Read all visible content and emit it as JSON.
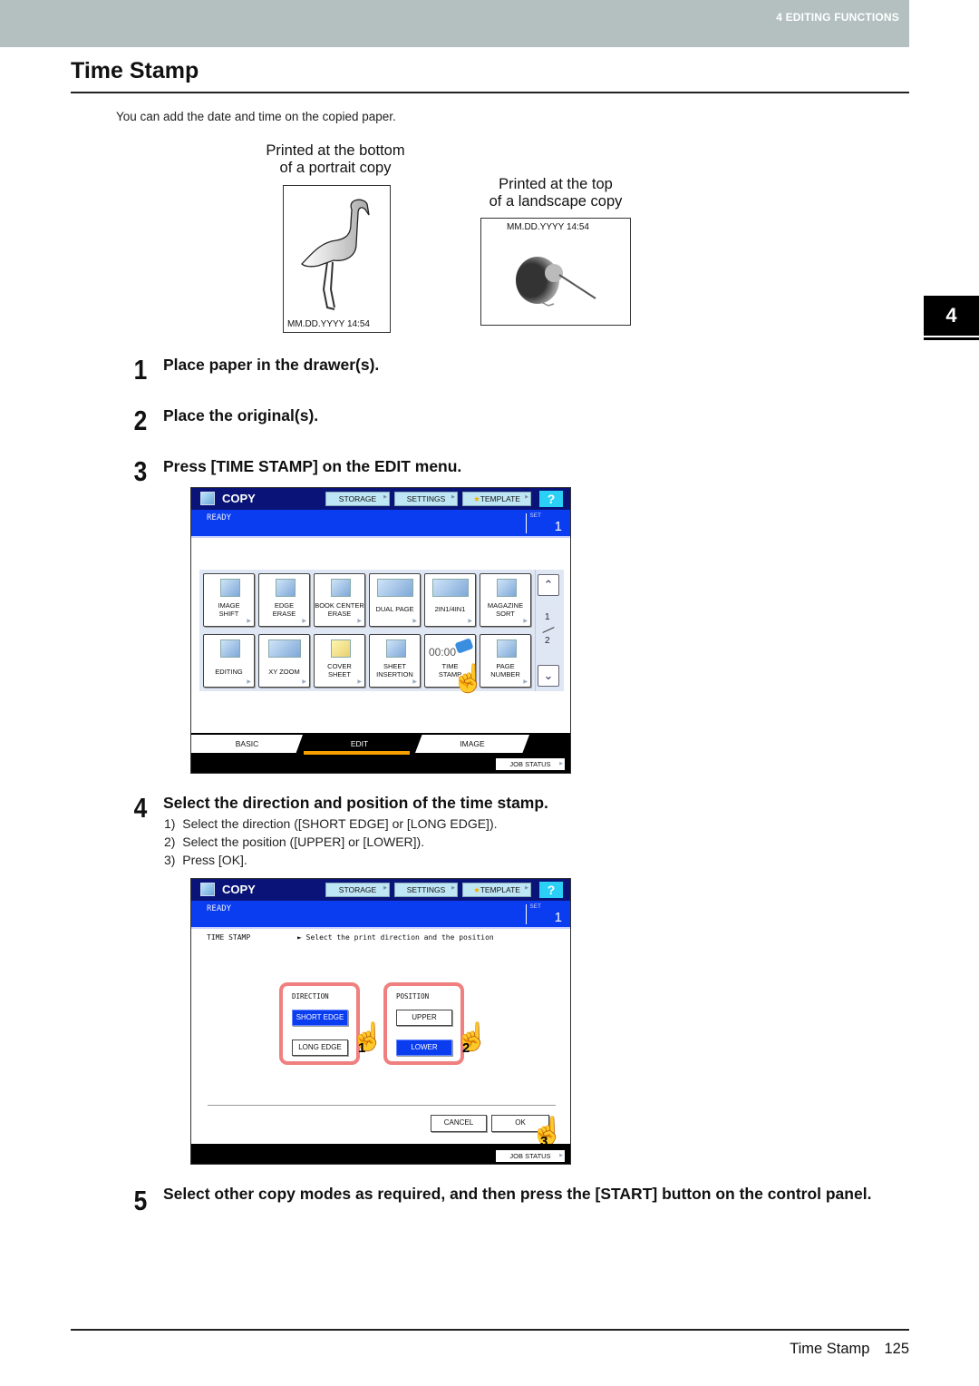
{
  "header": {
    "section": "4 EDITING FUNCTIONS"
  },
  "title": "Time Stamp",
  "intro": "You can add the date and time on the copied paper.",
  "illustrations": {
    "portrait": {
      "caption_line1": "Printed at the bottom",
      "caption_line2": "of a portrait copy",
      "stamp": "MM.DD.YYYY  14:54",
      "image": "flamingo"
    },
    "landscape": {
      "caption_line1": "Printed at the top",
      "caption_line2": "of a landscape copy",
      "stamp": "MM.DD.YYYY  14:54",
      "image": "kiwi"
    }
  },
  "chapter_tab": "4",
  "steps": [
    {
      "num": "1",
      "text": "Place paper in the drawer(s)."
    },
    {
      "num": "2",
      "text": "Place the original(s)."
    },
    {
      "num": "3",
      "text": "Press [TIME STAMP] on the EDIT menu."
    },
    {
      "num": "4",
      "text": "Select the direction and position of the time stamp.",
      "substeps": [
        {
          "n": "1)",
          "text": "Select the direction ([SHORT EDGE] or [LONG EDGE])."
        },
        {
          "n": "2)",
          "text": "Select the position ([UPPER] or [LOWER])."
        },
        {
          "n": "3)",
          "text": "Press [OK]."
        }
      ]
    },
    {
      "num": "5",
      "text": "Select other copy modes as required, and then press the [START] button on the control panel."
    }
  ],
  "panel_common": {
    "mode": "COPY",
    "buttons": [
      "STORAGE",
      "SETTINGS",
      "TEMPLATE"
    ],
    "help": "?",
    "status": "READY",
    "set_label": "SET",
    "set_value": "1",
    "job_status": "JOB STATUS"
  },
  "panel1": {
    "functions_row1": [
      {
        "l1": "IMAGE",
        "l2": "SHIFT"
      },
      {
        "l1": "EDGE",
        "l2": "ERASE"
      },
      {
        "l1": "BOOK CENTER",
        "l2": "ERASE"
      },
      {
        "l1": "DUAL PAGE",
        "l2": ""
      },
      {
        "l1": "2IN1/4IN1",
        "l2": ""
      },
      {
        "l1": "MAGAZINE",
        "l2": "SORT"
      }
    ],
    "functions_row2": [
      {
        "l1": "EDITING",
        "l2": ""
      },
      {
        "l1": "XY ZOOM",
        "l2": ""
      },
      {
        "l1": "COVER",
        "l2": "SHEET"
      },
      {
        "l1": "SHEET",
        "l2": "INSERTION"
      },
      {
        "l1": "TIME",
        "l2": "STAMP",
        "icon_text": "00:00"
      },
      {
        "l1": "PAGE",
        "l2": "NUMBER"
      }
    ],
    "page_current": "1",
    "page_total": "2",
    "tabs": [
      "BASIC",
      "EDIT",
      "IMAGE"
    ],
    "active_tab": "EDIT"
  },
  "panel2": {
    "screen_title": "TIME STAMP",
    "instruction": "► Select the print direction and the position",
    "direction": {
      "label": "DIRECTION",
      "options": [
        "SHORT EDGE",
        "LONG EDGE"
      ],
      "selected": "SHORT EDGE"
    },
    "position": {
      "label": "POSITION",
      "options": [
        "UPPER",
        "LOWER"
      ],
      "selected": "LOWER"
    },
    "cancel": "CANCEL",
    "ok": "OK",
    "callouts": [
      "1",
      "2",
      "3"
    ]
  },
  "footer": {
    "section": "Time Stamp",
    "page": "125"
  }
}
